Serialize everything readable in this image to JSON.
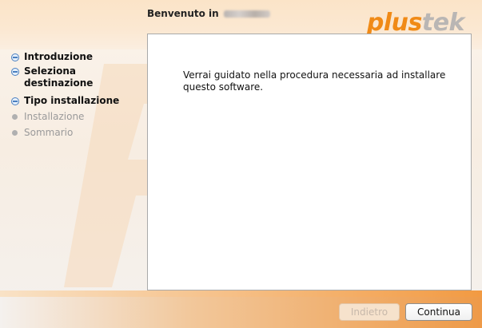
{
  "window": {
    "header_prefix": "Benvenuto in"
  },
  "logo": {
    "part1": "plus",
    "part2": "tek"
  },
  "sidebar": {
    "steps": [
      {
        "label": "Introduzione",
        "state": "active"
      },
      {
        "label": "Seleziona destinazione",
        "state": "done"
      },
      {
        "label": "Tipo installazione",
        "state": "done"
      },
      {
        "label": "Installazione",
        "state": "pending"
      },
      {
        "label": "Sommario",
        "state": "pending"
      }
    ]
  },
  "content": {
    "message": "Verrai guidato nella procedura necessaria ad installare questo software."
  },
  "footer": {
    "back_label": "Indietro",
    "next_label": "Continua"
  },
  "colors": {
    "brand_orange": "#f08a16",
    "brand_gray": "#b9b6b4",
    "step_blue": "#4a7fc0"
  }
}
